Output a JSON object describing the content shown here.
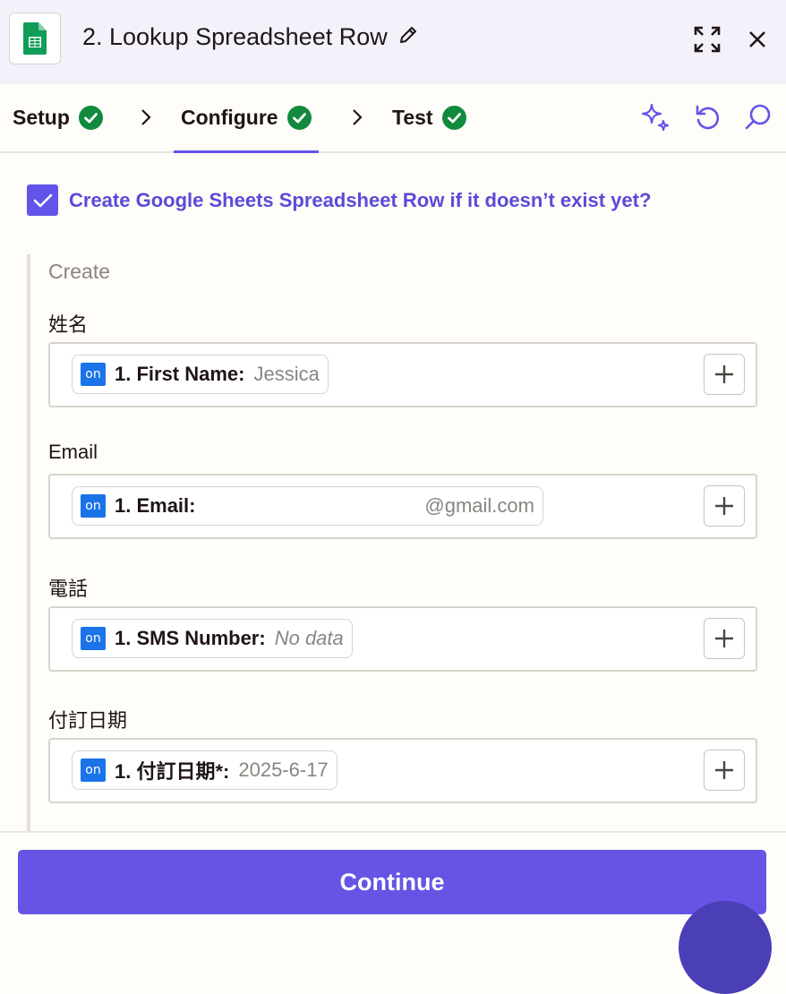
{
  "header": {
    "title": "2. Lookup Spreadsheet Row",
    "app_icon": "google-sheets-icon",
    "colors": {
      "background": "#f3f2fb",
      "sheets_green": "#0f9d58"
    }
  },
  "tabs": [
    {
      "label": "Setup",
      "status": "complete"
    },
    {
      "label": "Configure",
      "status": "complete",
      "active": true
    },
    {
      "label": "Test",
      "status": "complete"
    }
  ],
  "tools": [
    "ai-sparkle-icon",
    "refresh-icon",
    "search-icon"
  ],
  "create_option": {
    "checked": true,
    "label": "Create Google Sheets Spreadsheet Row if it doesn’t exist yet?"
  },
  "create_section": {
    "heading": "Create",
    "fields": [
      {
        "label": "姓名",
        "pill_source": "on",
        "pill_key": "1. First Name:",
        "pill_value": "Jessica"
      },
      {
        "label": "Email",
        "pill_source": "on",
        "pill_key": "1. Email:",
        "pill_value": "@gmail.com"
      },
      {
        "label": "電話",
        "pill_source": "on",
        "pill_key": "1. SMS Number:",
        "pill_value": "No data"
      },
      {
        "label": "付訂日期",
        "pill_source": "on",
        "pill_key": "1. 付訂日期*:",
        "pill_value": "2025-6-17"
      }
    ]
  },
  "footer": {
    "continue_label": "Continue"
  },
  "colors": {
    "accent": "#6254e8",
    "success": "#128a3e",
    "badge_blue": "#1a73e8"
  }
}
